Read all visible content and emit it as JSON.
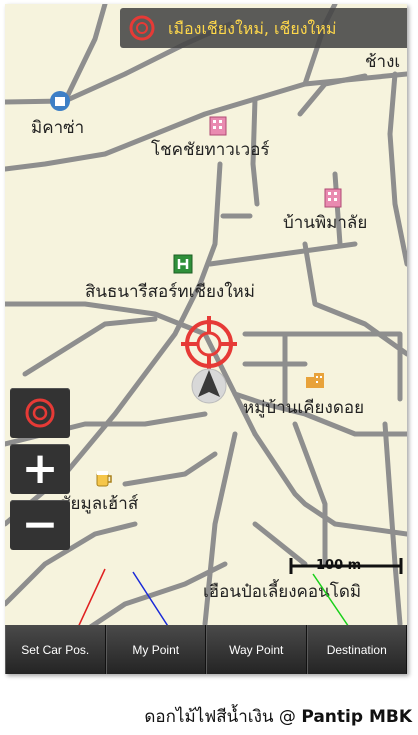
{
  "map": {
    "location": "เมืองเชียงใหม่, เชียงใหม่",
    "places": {
      "top_right": "ช้างเ",
      "mikasa": "มิคาซ่า",
      "chokchai": "โชคชัยทาวเวอร์",
      "banpim": "บ้านพิมาลัย",
      "hospital": "สินธนารีสอร์ทเชียงใหม่",
      "village": "หมู่บ้านเคียงดอย",
      "beer": "ชัยมูลเฮ้าส์",
      "heuan": "เฮือนป๋อเลี้ยงคอนโดมิ"
    },
    "scale_label": "100 m"
  },
  "zoom": {
    "plus": "+",
    "minus": "−"
  },
  "toolbar": {
    "set_car": "Set Car Pos.",
    "my_point": "My Point",
    "way_point": "Way Point",
    "destination": "Destination"
  },
  "caption": {
    "text": "ดอกไม้ไฟสีน้ำเงิน @ ",
    "brand": "Pantip MBK"
  },
  "colors": {
    "map_bg": "#f6f3dd",
    "road": "#8e8e8e",
    "accent": "#ffd84a",
    "target": "#e63a36"
  }
}
